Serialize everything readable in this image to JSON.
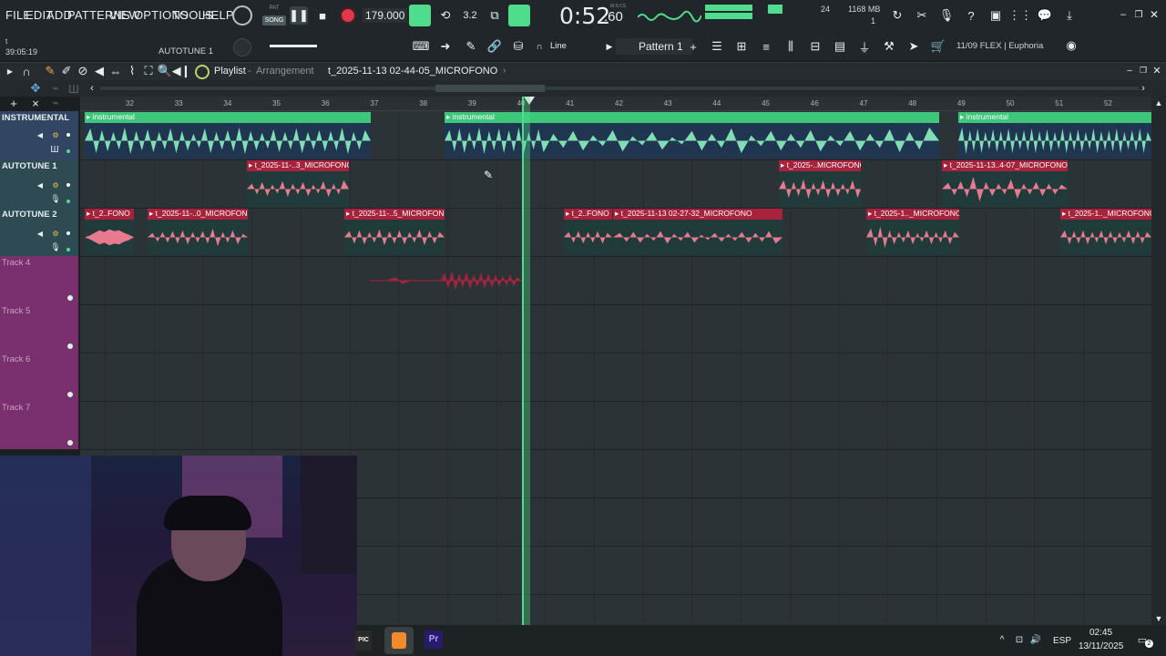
{
  "menu": [
    "FILE",
    "EDIT",
    "ADD",
    "PATTERNS",
    "VIEW",
    "OPTIONS",
    "TOOLS",
    "HELP"
  ],
  "transport": {
    "mode_pat": "PAT",
    "mode_song": "SONG",
    "tempo": "179.000",
    "time": "0:52",
    "time_frac": ":60",
    "time_unit": "M:S:CS",
    "cpu_num": "24",
    "memory": "1168 MB",
    "mem_sub": "1"
  },
  "hint": {
    "position": "39:05:19",
    "plugin": "AUTOTUNE 1",
    "snap": "Line",
    "pattern": "Pattern 1",
    "flex_label": "11/09  FLEX | Euphoria"
  },
  "playlist": {
    "title": "Playlist",
    "subtitle": "Arrangement",
    "current_clip": "t_2025-11-13 02-44-05_MICROFONO"
  },
  "ruler_ticks": [
    "32",
    "33",
    "34",
    "35",
    "36",
    "37",
    "38",
    "39",
    "40",
    "41",
    "42",
    "43",
    "44",
    "45",
    "46",
    "47",
    "48",
    "49",
    "50",
    "51",
    "52"
  ],
  "tracks": [
    {
      "name": "INSTRUMENTAL"
    },
    {
      "name": "AUTOTUNE 1"
    },
    {
      "name": "AUTOTUNE 2"
    },
    {
      "name": "Track 4"
    },
    {
      "name": "Track 5"
    },
    {
      "name": "Track 6"
    },
    {
      "name": "Track 7"
    }
  ],
  "clips": {
    "instrumental": [
      "instrumental",
      "instrumental",
      "instrumental"
    ],
    "autotune1": [
      "t_2025-11-..3_MICROFONO",
      "t_2025-..MICROFONO",
      "t_2025-11-13..4-07_MICROFONO"
    ],
    "autotune2": [
      "t_2..FONO",
      "t_2025-11-..0_MICROFONO",
      "t_2025-11-..5_MICROFONO",
      "t_2..FONO",
      "t_2025-11-13 02-27-32_MICROFONO",
      "t_2025-1.._MICROFONO",
      "t_2025-1.._MICROFONO"
    ]
  },
  "taskbar": {
    "lang": "ESP",
    "time": "02:45",
    "date": "13/11/2025",
    "notif_count": "2",
    "app_pr": "Pr"
  },
  "colors": {
    "accent": "#4fdc8c",
    "audio_clip": "#e8798e",
    "audio_clip_header": "#a8223c",
    "instrumental_clip": "#3ec77a",
    "track_head": "#7a2f6e"
  }
}
